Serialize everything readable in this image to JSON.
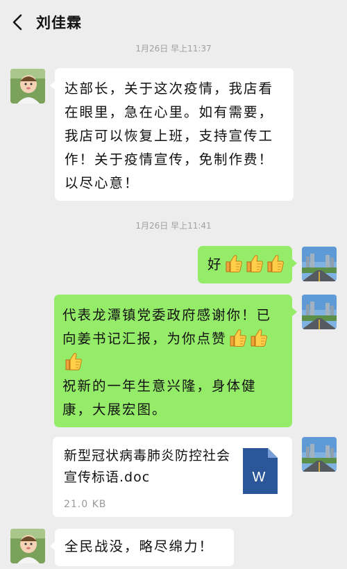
{
  "header": {
    "title": "刘佳霖"
  },
  "timestamps": [
    "1月26日  早上11:37",
    "1月26日  早上11:41"
  ],
  "messages": {
    "m1": "达部长，关于这次疫情，我店看在眼里，急在心里。如有需要，我店可以恢复上班，支持宣传工作！关于疫情宣传，免制作费！以尽心意！",
    "m2": "好",
    "m3_line1": "代表龙潭镇党委政府感谢你！已向姜书记汇报，为你点赞",
    "m3_line2": "祝新的一年生意兴隆，身体健康，大展宏图。",
    "file": {
      "name": "新型冠状病毒肺炎防控社会宣传标语.doc",
      "size": "21.0 KB",
      "type_letter": "W"
    },
    "m5": "全民战没，略尽绵力！"
  },
  "colors": {
    "background": "#ededed",
    "bubble_green": "#95ec69",
    "bubble_white": "#ffffff",
    "word_blue": "#2b579a"
  },
  "icons": [
    "back-arrow-icon",
    "thumbs-up-icon",
    "word-file-icon"
  ]
}
